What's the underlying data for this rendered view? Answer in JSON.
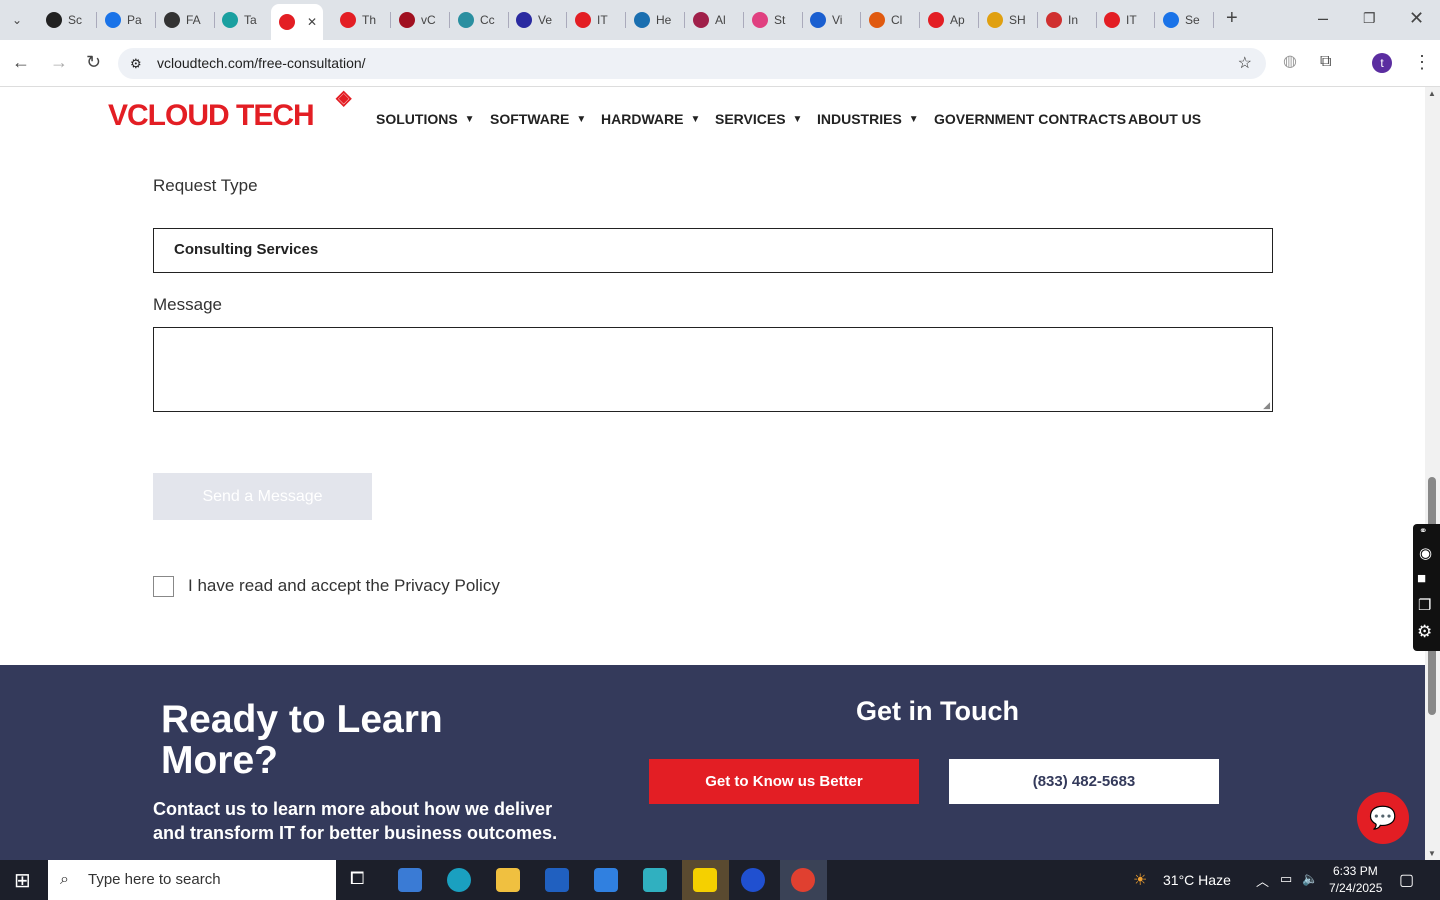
{
  "browser": {
    "tabs": [
      {
        "label": "Sc",
        "color": "#222"
      },
      {
        "label": "Pa",
        "color": "#1a73e8"
      },
      {
        "label": "FA",
        "color": "#333"
      },
      {
        "label": "Ta",
        "color": "#1aa0a0"
      },
      {
        "label": "",
        "color": "#e31e24"
      },
      {
        "label": "Th",
        "color": "#e31e24"
      },
      {
        "label": "vC",
        "color": "#a01020"
      },
      {
        "label": "Cc",
        "color": "#2a8fa0"
      },
      {
        "label": "Ve",
        "color": "#2a2aa0"
      },
      {
        "label": "IT",
        "color": "#e31e24"
      },
      {
        "label": "He",
        "color": "#1a6fb0"
      },
      {
        "label": "Al",
        "color": "#a0204a"
      },
      {
        "label": "St",
        "color": "#e04080"
      },
      {
        "label": "Vi",
        "color": "#1a5fd0"
      },
      {
        "label": "Cl",
        "color": "#e05a10"
      },
      {
        "label": "Ap",
        "color": "#e31e24"
      },
      {
        "label": "SH",
        "color": "#e0a010"
      },
      {
        "label": "In",
        "color": "#d03030"
      },
      {
        "label": "IT",
        "color": "#e31e24"
      },
      {
        "label": "Se",
        "color": "#1a73e8"
      }
    ],
    "url": "vcloudtech.com/free-consultation/",
    "profile_initial": "t"
  },
  "site": {
    "logo_main": "VCLOUD TECH",
    "nav": [
      {
        "label": "SOLUTIONS",
        "caret": true
      },
      {
        "label": "SOFTWARE",
        "caret": true
      },
      {
        "label": "HARDWARE",
        "caret": true
      },
      {
        "label": "SERVICES",
        "caret": true
      },
      {
        "label": "INDUSTRIES",
        "caret": true
      },
      {
        "label": "GOVERNMENT CONTRACTS",
        "caret": false
      },
      {
        "label": "ABOUT US",
        "caret": false
      }
    ]
  },
  "form": {
    "request_type_label": "Request Type",
    "request_type_value": "Consulting Services",
    "message_label": "Message",
    "message_value": "",
    "submit_label": "Send a Message",
    "privacy_label": "I have read and accept the Privacy Policy"
  },
  "footer": {
    "heading": "Ready to Learn More?",
    "subtext": "Contact us to learn more about how we deliver and transform IT for better business outcomes.",
    "get_in_touch": "Get in Touch",
    "cta_primary": "Get to Know us Better",
    "cta_phone": "(833) 482-5683",
    "colors": {
      "bg": "#343a5b",
      "accent": "#e31e24"
    }
  },
  "taskbar": {
    "search_placeholder": "Type here to search",
    "weather": "31°C  Haze",
    "time": "6:33 PM",
    "date": "7/24/2025"
  }
}
